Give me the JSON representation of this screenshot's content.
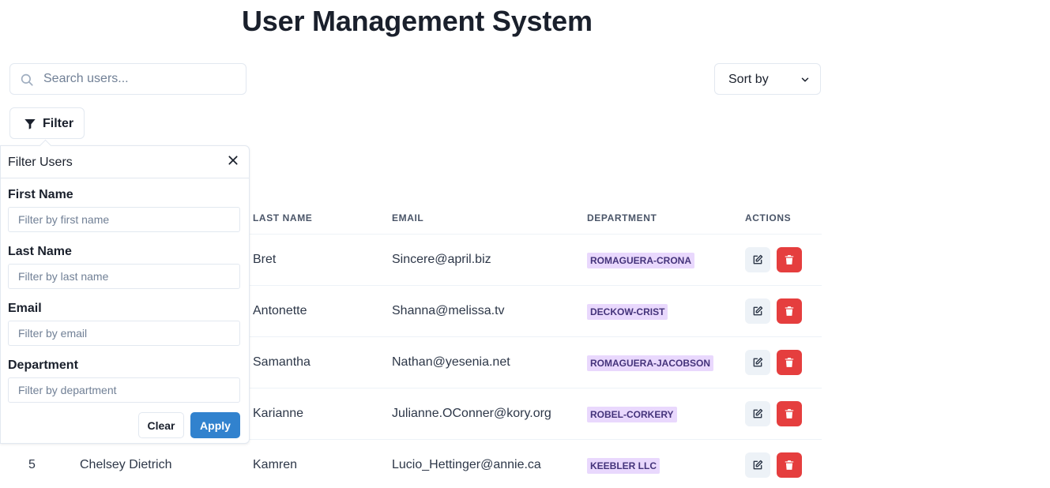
{
  "page": {
    "title": "User Management System"
  },
  "search": {
    "placeholder": "Search users...",
    "icon": "search-icon"
  },
  "sort": {
    "label": "Sort by",
    "icon": "chevron-down-icon"
  },
  "filter_button": {
    "label": "Filter",
    "icon": "filter-icon"
  },
  "table": {
    "headers": {
      "last_name": "LAST NAME",
      "email": "EMAIL",
      "department": "DEPARTMENT",
      "actions": "ACTIONS"
    },
    "rows": [
      {
        "id": "",
        "name": "",
        "last_name": "Bret",
        "email": "Sincere@april.biz",
        "department": "ROMAGUERA-CRONA"
      },
      {
        "id": "",
        "name": "",
        "last_name": "Antonette",
        "email": "Shanna@melissa.tv",
        "department": "DECKOW-CRIST"
      },
      {
        "id": "",
        "name": "",
        "last_name": "Samantha",
        "email": "Nathan@yesenia.net",
        "department": "ROMAGUERA-JACOBSON"
      },
      {
        "id": "",
        "name": "",
        "last_name": "Karianne",
        "email": "Julianne.OConner@kory.org",
        "department": "ROBEL-CORKERY"
      },
      {
        "id": "5",
        "name": "Chelsey Dietrich",
        "last_name": "Kamren",
        "email": "Lucio_Hettinger@annie.ca",
        "department": "KEEBLER LLC"
      }
    ],
    "badge_colors": {
      "background": "#e9d8fd",
      "text": "#44337a"
    },
    "delete_color": "#e53e3e"
  },
  "filter_popover": {
    "title": "Filter Users",
    "fields": [
      {
        "label": "First Name",
        "placeholder": "Filter by first name",
        "value": ""
      },
      {
        "label": "Last Name",
        "placeholder": "Filter by last name",
        "value": ""
      },
      {
        "label": "Email",
        "placeholder": "Filter by email",
        "value": ""
      },
      {
        "label": "Department",
        "placeholder": "Filter by department",
        "value": ""
      }
    ],
    "clear_label": "Clear",
    "apply_label": "Apply",
    "apply_color": "#3182ce"
  }
}
